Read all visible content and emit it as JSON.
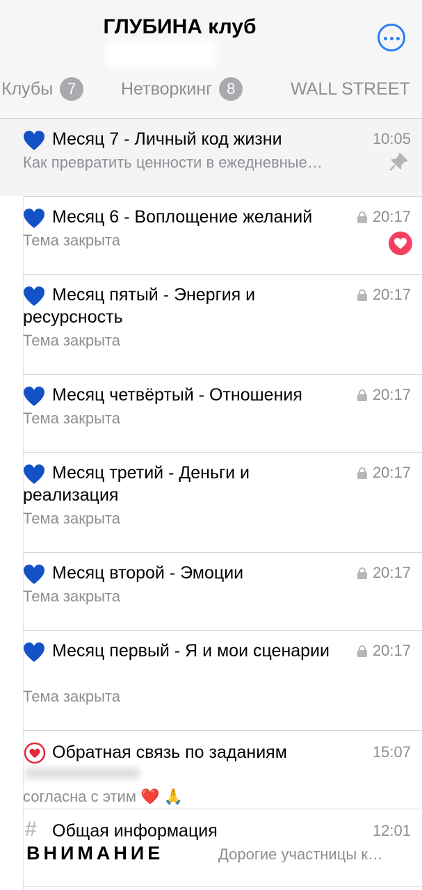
{
  "header": {
    "title": "ГЛУБИНА клуб"
  },
  "tabs": [
    {
      "label": "Клубы",
      "count": "7"
    },
    {
      "label": "Нетворкинг",
      "count": "8"
    },
    {
      "label": "WALL STREET",
      "count": ""
    }
  ],
  "topics": [
    {
      "title": "Месяц 7 - Личный код жизни",
      "time": "10:05",
      "subtitle": "Как превратить ценности в ежедневные…",
      "icon": "blue-heart-icon",
      "locked": false,
      "pinned": true
    },
    {
      "title": "Месяц 6 - Воплощение желаний",
      "time": "20:17",
      "subtitle": "Тема закрыта",
      "icon": "blue-heart-icon",
      "locked": true,
      "unread": true
    },
    {
      "title": "Месяц пятый - Энергия и ресурсность",
      "time": "20:17",
      "subtitle": "Тема закрыта",
      "icon": "blue-heart-icon",
      "locked": true
    },
    {
      "title": "Месяц четвёртый - Отношения",
      "time": "20:17",
      "subtitle": "Тема закрыта",
      "icon": "blue-heart-icon",
      "locked": true
    },
    {
      "title": "Месяц третий - Деньги и реализация",
      "time": "20:17",
      "subtitle": "Тема закрыта",
      "icon": "blue-heart-icon",
      "locked": true
    },
    {
      "title": "Месяц второй - Эмоции",
      "time": "20:17",
      "subtitle": "Тема закрыта",
      "icon": "blue-heart-icon",
      "locked": true
    },
    {
      "title": "Месяц первый - Я и мои сценарии",
      "time": "20:17",
      "subtitle": "Тема закрыта",
      "icon": "blue-heart-icon",
      "locked": true
    },
    {
      "title": "Обратная связь по заданиям",
      "time": "15:07",
      "subtitle": "согласна с этим ❤️ 🙏",
      "icon": "red-heart-circle-icon",
      "locked": false
    },
    {
      "title": "Общая информация",
      "time": "12:01",
      "subtitle_bold": "ВНИМАНИЕ",
      "subtitle": "Дорогие участницы к…",
      "icon": "hashtag-icon",
      "locked": false
    }
  ],
  "colors": {
    "accent": "#2c7ff2",
    "heart_blue": "#1252c4",
    "unread": "#f3415f",
    "secondary_text": "#8e8e93"
  }
}
